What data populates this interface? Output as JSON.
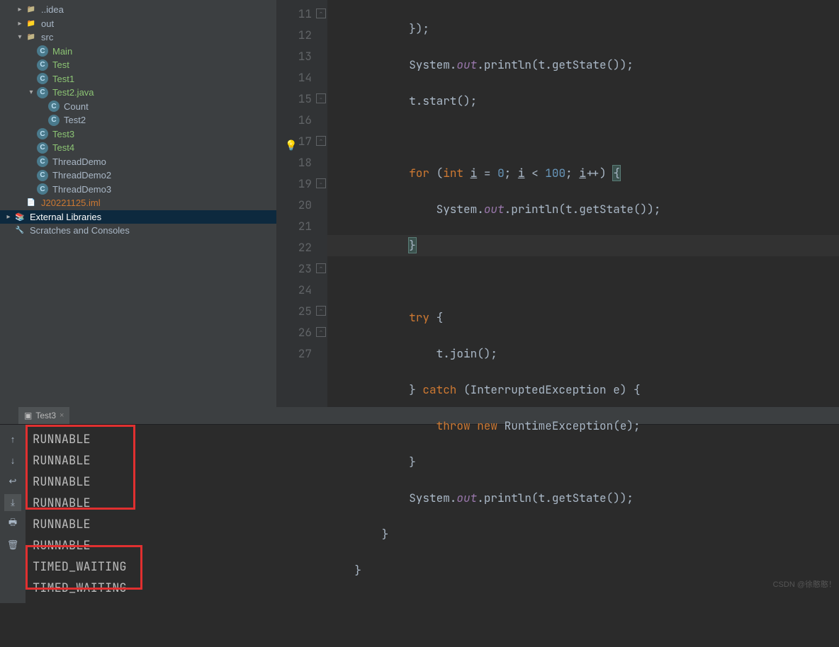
{
  "tree": {
    "idea": "..idea",
    "out": "out",
    "src": "src",
    "main": "Main",
    "test": "Test",
    "test1": "Test1",
    "test2java": "Test2.java",
    "count": "Count",
    "test2": "Test2",
    "test3": "Test3",
    "test4": "Test4",
    "td": "ThreadDemo",
    "td2": "ThreadDemo2",
    "td3": "ThreadDemo3",
    "iml": "J20221125.iml",
    "extlib": "External Libraries",
    "scratches": "Scratches and Consoles"
  },
  "gutter": [
    "11",
    "12",
    "13",
    "14",
    "15",
    "16",
    "17",
    "18",
    "19",
    "20",
    "21",
    "22",
    "23",
    "24",
    "25",
    "26",
    "27"
  ],
  "code": {
    "l11a": "            });",
    "l12a": "            System.",
    "l12b": "out",
    "l12c": ".println(t.getState());",
    "l13a": "            t.start();",
    "l15a": "            ",
    "l15b": "for",
    "l15c": " (",
    "l15d": "int",
    "l15e": " ",
    "l15f": "i",
    "l15g": " = ",
    "l15h": "0",
    "l15i": "; ",
    "l15j": "i",
    "l15k": " < ",
    "l15l": "100",
    "l15m": "; ",
    "l15n": "i",
    "l15o": "++) ",
    "l15p": "{",
    "l16a": "                System.",
    "l16b": "out",
    "l16c": ".println(t.getState());",
    "l17a": "            ",
    "l17b": "}",
    "l19a": "            ",
    "l19b": "try",
    "l19c": " {",
    "l20a": "                t.join();",
    "l21a": "            } ",
    "l21b": "catch",
    "l21c": " (InterruptedException e) {",
    "l22a": "                ",
    "l22b": "throw new",
    "l22c": " RuntimeException(e);",
    "l23a": "            }",
    "l24a": "            System.",
    "l24b": "out",
    "l24c": ".println(t.getState());",
    "l25a": "        }",
    "l26a": "    }"
  },
  "run": {
    "tab": "Test3",
    "lines": [
      "RUNNABLE",
      "RUNNABLE",
      "RUNNABLE",
      "RUNNABLE",
      "RUNNABLE",
      "RUNNABLE",
      "TIMED_WAITING",
      "TIMED_WAITING"
    ]
  },
  "watermark": "CSDN @徐憨憨！"
}
